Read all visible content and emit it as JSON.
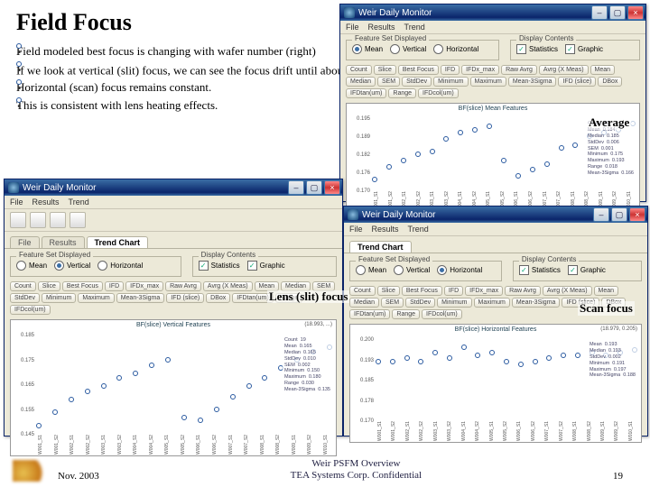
{
  "slide": {
    "title": "Field Focus",
    "bullets": [
      "Field modeled best focus is changing with wafer number (right)",
      "If we look at vertical (slit) focus, we can see the focus drift until about the 6th wafer.",
      "Horizontal (scan) focus remains constant.",
      "This is consistent with lens heating effects."
    ],
    "footer_date": "Nov. 2003",
    "footer_center_l1": "Weir PSFM Overview",
    "footer_center_l2": "TEA Systems Corp. Confidential",
    "footer_page": "19"
  },
  "annotations": {
    "average": "Average",
    "lens": "Lens (slit) focus",
    "scan": "Scan focus"
  },
  "app": {
    "title": "Weir Daily Monitor",
    "menus": [
      "File",
      "Results",
      "Trend"
    ],
    "tabs": [
      "File",
      "Results",
      "Trend Chart"
    ]
  },
  "featureset": {
    "legend": "Feature Set Displayed",
    "options": [
      "Mean",
      "Vertical",
      "Horizontal"
    ]
  },
  "display": {
    "legend": "Display Contents",
    "statistics": "Statistics",
    "graphic": "Graphic"
  },
  "stat_buttons": [
    "Count",
    "Slice",
    "Best Focus",
    "IFD",
    "IFDx_max",
    "Raw Avrg",
    "Avrg (X Meas)",
    "Mean",
    "Median",
    "SEM",
    "StdDev",
    "Minimum",
    "Maximum",
    "Mean-3Sigma",
    "IFD (slice)",
    "DBox",
    "IFDtan(um)",
    "Range",
    "IFDcol(um)"
  ],
  "chart_data": [
    {
      "title": "BF(slice) Mean Features",
      "type": "scatter",
      "series": "Mean",
      "values": [
        0.175,
        0.179,
        0.181,
        0.183,
        0.184,
        0.188,
        0.19,
        0.191,
        0.192,
        0.181,
        0.176,
        0.178,
        0.18,
        0.185,
        0.186,
        0.189,
        0.19,
        0.191,
        0.193
      ],
      "ylim": [
        0.17,
        0.195
      ],
      "stats": {
        "Count": "19",
        "Mean": "0.184",
        "Median": "0.185",
        "StdDev": "0.006",
        "SEM": "0.001",
        "Minimum": "0.175",
        "Maximum": "0.193",
        "Range": "0.018",
        "Mean-3Sigma": "0.166"
      }
    },
    {
      "title": "BF(slice) Vertical Features",
      "corner": "(18.993, ...)",
      "type": "scatter",
      "series": "Vertical",
      "values": [
        0.15,
        0.155,
        0.16,
        0.163,
        0.165,
        0.168,
        0.17,
        0.173,
        0.175,
        0.153,
        0.152,
        0.156,
        0.161,
        0.165,
        0.168,
        0.172,
        0.175,
        0.178,
        0.18
      ],
      "ylim": [
        0.145,
        0.185
      ],
      "stats": {
        "Count": "19",
        "Mean": "0.165",
        "Median": "0.165",
        "StdDev": "0.010",
        "SEM": "0.002",
        "Minimum": "0.150",
        "Maximum": "0.180",
        "Range": "0.030",
        "Mean-3Sigma": "0.135"
      }
    },
    {
      "title": "BF(slice) Horizontal Features",
      "corner": "(18.979, 0.205)",
      "type": "scatter",
      "series": "Horizontal",
      "values": [
        0.192,
        0.192,
        0.193,
        0.192,
        0.195,
        0.193,
        0.197,
        0.194,
        0.195,
        0.192,
        0.191,
        0.192,
        0.193,
        0.194,
        0.194,
        0.195,
        0.194,
        0.195,
        0.196
      ],
      "ylim": [
        0.17,
        0.2
      ],
      "stats": {
        "Mean": "0.193",
        "Median": "0.193",
        "StdDev": "0.002",
        "Minimum": "0.191",
        "Maximum": "0.197",
        "Mean-3Sigma": "0.188"
      }
    }
  ],
  "x_categories": [
    "W001_S1",
    "W001_S2",
    "W002_S1",
    "W002_S2",
    "W003_S1",
    "W003_S2",
    "W004_S1",
    "W004_S2",
    "W005_S1",
    "W005_S2",
    "W006_S1",
    "W006_S2",
    "W007_S1",
    "W007_S2",
    "W008_S1",
    "W008_S2",
    "W009_S1",
    "W009_S2",
    "W010_S1"
  ]
}
